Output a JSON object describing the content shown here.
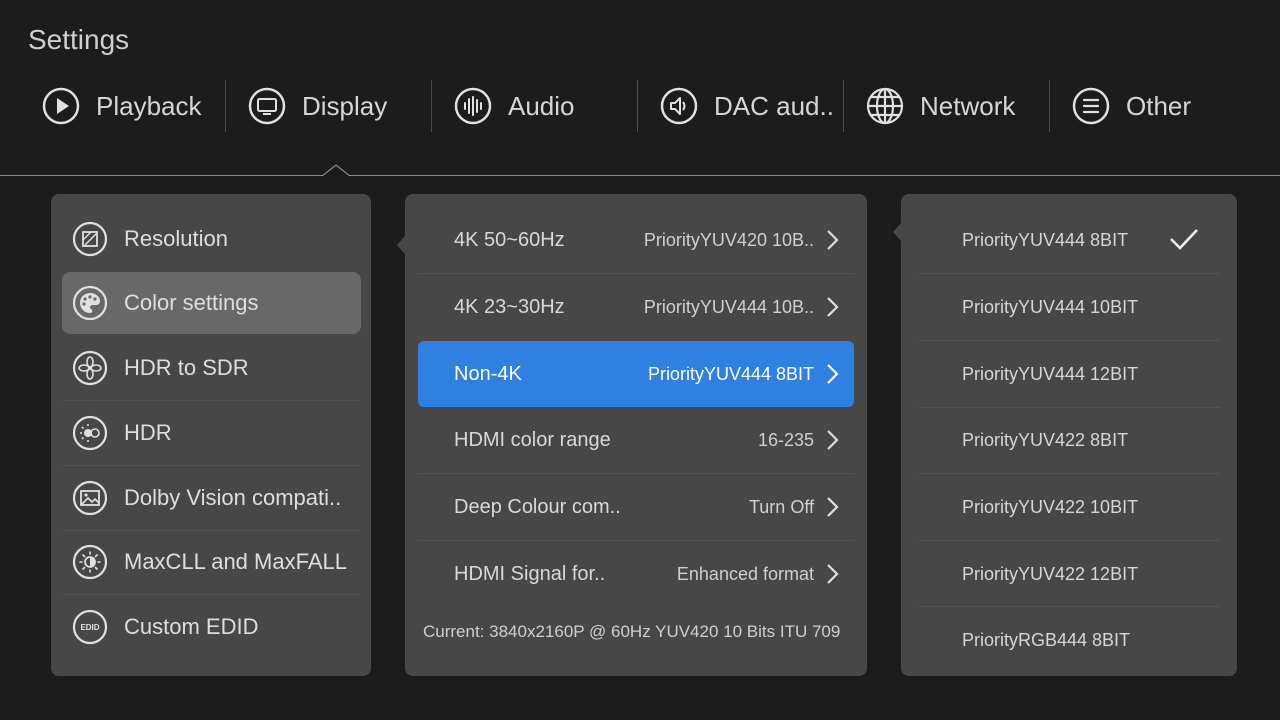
{
  "header": {
    "title": "Settings"
  },
  "tabs": [
    {
      "label": "Playback",
      "icon": "play-circle-icon"
    },
    {
      "label": "Display",
      "icon": "monitor-icon"
    },
    {
      "label": "Audio",
      "icon": "audio-wave-icon"
    },
    {
      "label": "DAC aud..",
      "icon": "speaker-icon"
    },
    {
      "label": "Network",
      "icon": "globe-icon"
    },
    {
      "label": "Other",
      "icon": "menu-icon"
    }
  ],
  "active_tab": "Display",
  "display_menu": [
    {
      "label": "Resolution",
      "icon": "resolution-icon"
    },
    {
      "label": "Color settings",
      "icon": "palette-icon",
      "selected": true
    },
    {
      "label": "HDR to SDR",
      "icon": "flower-icon"
    },
    {
      "label": "HDR",
      "icon": "hdr-icon"
    },
    {
      "label": "Dolby Vision compati..",
      "icon": "image-icon"
    },
    {
      "label": "MaxCLL and MaxFALL",
      "icon": "brightness-icon"
    },
    {
      "label": "Custom EDID",
      "icon": "edid-icon",
      "icon_text": "EDID"
    }
  ],
  "color_settings": [
    {
      "label": "4K 50~60Hz",
      "value": "PriorityYUV420 10B.."
    },
    {
      "label": "4K 23~30Hz",
      "value": "PriorityYUV444 10B.."
    },
    {
      "label": "Non-4K",
      "value": "PriorityYUV444 8BIT",
      "selected": true
    },
    {
      "label": "HDMI color range",
      "value": "16-235"
    },
    {
      "label": "Deep Colour com..",
      "value": "Turn Off"
    },
    {
      "label": "HDMI Signal for..",
      "value": "Enhanced format"
    }
  ],
  "current_status": "Current: 3840x2160P @ 60Hz  YUV420  10 Bits  ITU 709",
  "format_options": [
    {
      "label": "PriorityYUV444 8BIT",
      "checked": true
    },
    {
      "label": "PriorityYUV444 10BIT"
    },
    {
      "label": "PriorityYUV444 12BIT"
    },
    {
      "label": "PriorityYUV422 8BIT"
    },
    {
      "label": "PriorityYUV422 10BIT"
    },
    {
      "label": "PriorityYUV422 12BIT"
    },
    {
      "label": "PriorityRGB444 8BIT"
    }
  ],
  "colors": {
    "background": "#1c1c1c",
    "panel": "#474747",
    "selected_gray": "#686868",
    "accent_blue": "#2f80e0"
  }
}
